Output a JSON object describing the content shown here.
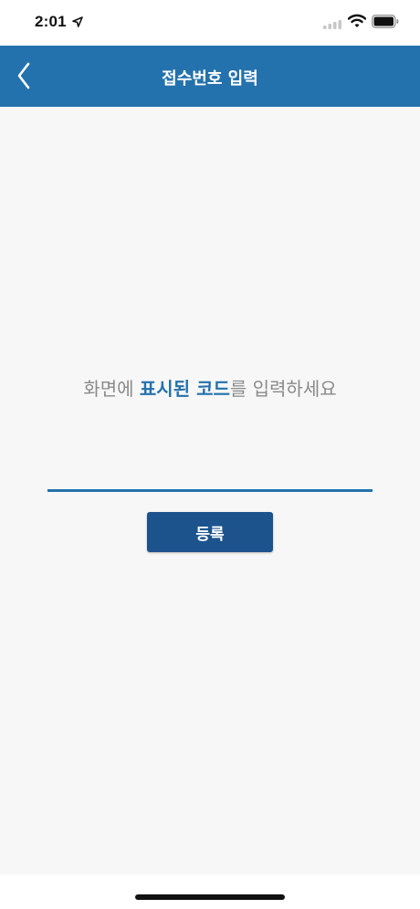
{
  "status_bar": {
    "time": "2:01",
    "location_icon": "location-arrow-icon",
    "signal_icon": "cellular-signal-icon",
    "wifi_icon": "wifi-icon",
    "battery_icon": "battery-icon"
  },
  "nav": {
    "title": "접수번호 입력",
    "back_icon": "chevron-left-icon"
  },
  "main": {
    "instruction_prefix": "화면에 ",
    "instruction_highlight": "표시된 코드",
    "instruction_suffix": "를 입력하세요",
    "code_input_value": "",
    "code_input_placeholder": "",
    "register_label": "등록"
  },
  "colors": {
    "primary": "#2472ad",
    "button": "#1c538d",
    "background": "#f7f7f7",
    "instruction_text": "#8a8a8a"
  }
}
